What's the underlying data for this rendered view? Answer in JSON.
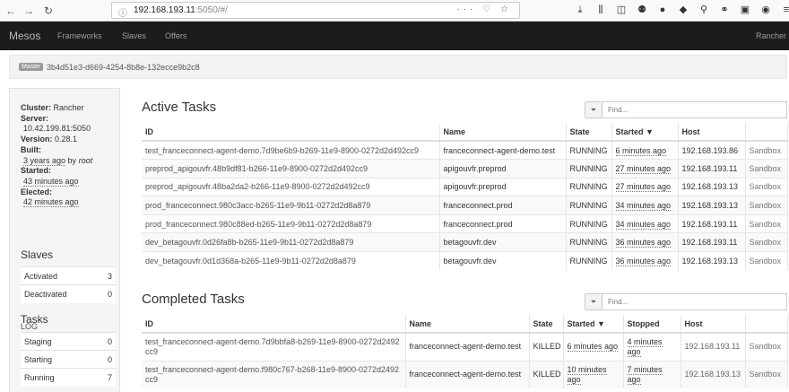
{
  "browser": {
    "url_host": "192.168.193.11",
    "url_rest": ":5050/#/",
    "page_actions": "··· ♡ ☆",
    "toolbar_icons": [
      "download-icon",
      "library-icon",
      "sidebar-icon",
      "extension-icon",
      "extension-icon",
      "extension-icon",
      "extension-icon",
      "extension-icon",
      "extension-icon",
      "extension-icon",
      "menu-icon"
    ]
  },
  "navbar": {
    "brand": "Mesos",
    "links": [
      "Frameworks",
      "Slaves",
      "Offers"
    ],
    "right": "Rancher"
  },
  "master": {
    "label": "Master",
    "id": "3b4d51e3-d669-4254-8b8e-132ecce9b2c8"
  },
  "sidebar": {
    "cluster_label": "Cluster:",
    "cluster_value": "Rancher",
    "server_label": "Server:",
    "server_value": "10.42.199.81:5050",
    "version_label": "Version:",
    "version_value": "0.28.1",
    "built_label": "Built:",
    "built_value": "3 years ago",
    "built_by": "by",
    "built_user": "root",
    "started_label": "Started:",
    "started_value": "43 minutes ago",
    "elected_label": "Elected:",
    "elected_value": "42 minutes ago",
    "log": "LOG",
    "slaves_heading": "Slaves",
    "slaves": [
      {
        "label": "Activated",
        "value": "3"
      },
      {
        "label": "Deactivated",
        "value": "0"
      }
    ],
    "tasks_heading": "Tasks",
    "tasks": [
      {
        "label": "Staging",
        "value": "0"
      },
      {
        "label": "Starting",
        "value": "0"
      },
      {
        "label": "Running",
        "value": "7"
      }
    ]
  },
  "active": {
    "title": "Active Tasks",
    "filter_placeholder": "Find...",
    "filter_icon": "filter-icon",
    "headers": [
      "ID",
      "Name",
      "State",
      "Started ▼",
      "Host",
      ""
    ],
    "rows": [
      {
        "id": "test_franceconnect-agent-demo.7d9be6b9-b269-11e9-8900-0272d2d492cc9",
        "name": "franceconnect-agent-demo.test",
        "state": "RUNNING",
        "started": "6 minutes ago",
        "host": "192.168.193.86",
        "sandbox": "Sandbox"
      },
      {
        "id": "preprod_apigouvfr.48b9df81-b266-11e9-8900-0272d2d492cc9",
        "name": "apigouvfr.preprod",
        "state": "RUNNING",
        "started": "27 minutes ago",
        "host": "192.168.193.11",
        "sandbox": "Sandbox"
      },
      {
        "id": "preprod_apigouvfr.48ba2da2-b266-11e9-8900-0272d2d492cc9",
        "name": "apigouvfr.preprod",
        "state": "RUNNING",
        "started": "27 minutes ago",
        "host": "192.168.193.13",
        "sandbox": "Sandbox"
      },
      {
        "id": "prod_franceconnect.980c3acc-b265-11e9-9b11-0272d2d8a879",
        "name": "franceconnect.prod",
        "state": "RUNNING",
        "started": "34 minutes ago",
        "host": "192.168.193.13",
        "sandbox": "Sandbox"
      },
      {
        "id": "prod_franceconnect.980c88ed-b265-11e9-9b11-0272d2d8a879",
        "name": "franceconnect.prod",
        "state": "RUNNING",
        "started": "34 minutes ago",
        "host": "192.168.193.11",
        "sandbox": "Sandbox"
      },
      {
        "id": "dev_betagouvfr.0d26fa8b-b265-11e9-9b11-0272d2d8a879",
        "name": "betagouvfr.dev",
        "state": "RUNNING",
        "started": "36 minutes ago",
        "host": "192.168.193.11",
        "sandbox": "Sandbox"
      },
      {
        "id": "dev_betagouvfr.0d1d368a-b265-11e9-9b11-0272d2d8a879",
        "name": "betagouvfr.dev",
        "state": "RUNNING",
        "started": "36 minutes ago",
        "host": "192.168.193.13",
        "sandbox": "Sandbox"
      }
    ]
  },
  "completed": {
    "title": "Completed Tasks",
    "filter_placeholder": "Find...",
    "filter_icon": "filter-icon",
    "headers": [
      "ID",
      "Name",
      "State",
      "Started ▼",
      "Stopped",
      "Host",
      ""
    ],
    "rows": [
      {
        "id": "test_franceconnect-agent-demo.7d9bbfa8-b269-11e9-8900-0272d2492cc9",
        "name": "franceconnect-agent-demo.test",
        "state": "KILLED",
        "started": "6 minutes ago",
        "stopped": "4 minutes ago",
        "host": "192.168.193.11",
        "sandbox": "Sandbox"
      },
      {
        "id": "test_franceconnect-agent-demo.f980c767-b268-11e9-8900-0272d2492cc9",
        "name": "franceconnect-agent-demo.test",
        "state": "KILLED",
        "started": "10 minutes ago",
        "stopped": "7 minutes ago",
        "host": "192.168.193.13",
        "sandbox": "Sandbox"
      }
    ]
  }
}
